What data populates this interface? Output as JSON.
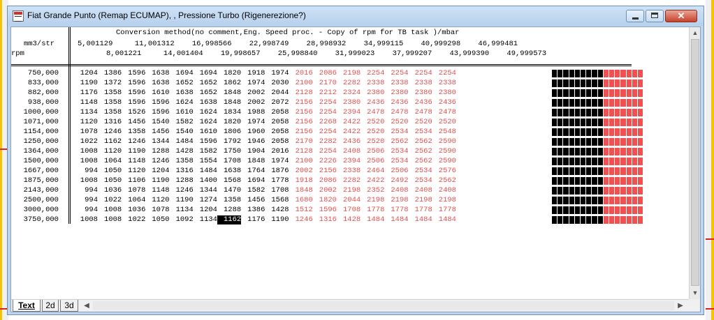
{
  "window": {
    "title": "Fiat Grande Punto (Remap ECUMAP), , Pressione Turbo (Rigenerezione?)",
    "close_glyph": "✕"
  },
  "map": {
    "heading": "Conversion method(no comment,Eng. Speed proc. - Copy of rpm for TB task )/mbar",
    "x_axis_label": "mm3/str",
    "x_axis_values_odd": "5,001129     11,001312    16,998566    22,998749    28,998932    34,999115    40,999298    46,999481",
    "x_axis_values_even": "8,001221     14,001404    19,998657    25,998840    31,999023    37,999207    43,999390    49,999573",
    "y_axis_label": "rpm",
    "rows": [
      {
        "rpm": "750,000",
        "cells": [
          "1204",
          "1386",
          "1596",
          "1638",
          "1694",
          "1694",
          "1820",
          "1918",
          "1974",
          "2016",
          "2086",
          "2198",
          "2254",
          "2254",
          "2254",
          "2254"
        ]
      },
      {
        "rpm": "833,000",
        "cells": [
          "1190",
          "1372",
          "1596",
          "1638",
          "1652",
          "1652",
          "1862",
          "1974",
          "2030",
          "2100",
          "2170",
          "2282",
          "2338",
          "2338",
          "2338",
          "2338"
        ]
      },
      {
        "rpm": "882,000",
        "cells": [
          "1176",
          "1358",
          "1596",
          "1610",
          "1638",
          "1652",
          "1848",
          "2002",
          "2044",
          "2128",
          "2212",
          "2324",
          "2380",
          "2380",
          "2380",
          "2380"
        ]
      },
      {
        "rpm": "938,000",
        "cells": [
          "1148",
          "1358",
          "1596",
          "1596",
          "1624",
          "1638",
          "1848",
          "2002",
          "2072",
          "2156",
          "2254",
          "2380",
          "2436",
          "2436",
          "2436",
          "2436"
        ]
      },
      {
        "rpm": "1000,000",
        "cells": [
          "1134",
          "1358",
          "1526",
          "1596",
          "1610",
          "1624",
          "1834",
          "1988",
          "2058",
          "2156",
          "2254",
          "2394",
          "2478",
          "2478",
          "2478",
          "2478"
        ]
      },
      {
        "rpm": "1071,000",
        "cells": [
          "1120",
          "1316",
          "1456",
          "1540",
          "1582",
          "1624",
          "1820",
          "1974",
          "2058",
          "2156",
          "2268",
          "2422",
          "2520",
          "2520",
          "2520",
          "2520"
        ]
      },
      {
        "rpm": "1154,000",
        "cells": [
          "1078",
          "1246",
          "1358",
          "1456",
          "1540",
          "1610",
          "1806",
          "1960",
          "2058",
          "2156",
          "2254",
          "2422",
          "2520",
          "2534",
          "2534",
          "2548"
        ]
      },
      {
        "rpm": "1250,000",
        "cells": [
          "1022",
          "1162",
          "1246",
          "1344",
          "1484",
          "1596",
          "1792",
          "1946",
          "2058",
          "2170",
          "2282",
          "2436",
          "2520",
          "2562",
          "2562",
          "2590"
        ]
      },
      {
        "rpm": "1364,000",
        "cells": [
          "1008",
          "1120",
          "1190",
          "1288",
          "1428",
          "1582",
          "1750",
          "1904",
          "2016",
          "2128",
          "2254",
          "2408",
          "2506",
          "2534",
          "2562",
          "2590"
        ]
      },
      {
        "rpm": "1500,000",
        "cells": [
          "1008",
          "1064",
          "1148",
          "1246",
          "1358",
          "1554",
          "1708",
          "1848",
          "1974",
          "2100",
          "2226",
          "2394",
          "2506",
          "2534",
          "2562",
          "2590"
        ]
      },
      {
        "rpm": "1667,000",
        "cells": [
          "994",
          "1050",
          "1120",
          "1204",
          "1316",
          "1484",
          "1638",
          "1764",
          "1876",
          "2002",
          "2156",
          "2338",
          "2464",
          "2506",
          "2534",
          "2576"
        ]
      },
      {
        "rpm": "1875,000",
        "cells": [
          "1008",
          "1050",
          "1106",
          "1190",
          "1288",
          "1400",
          "1568",
          "1694",
          "1778",
          "1918",
          "2086",
          "2282",
          "2422",
          "2492",
          "2534",
          "2562"
        ]
      },
      {
        "rpm": "2143,000",
        "cells": [
          "994",
          "1036",
          "1078",
          "1148",
          "1246",
          "1344",
          "1470",
          "1582",
          "1708",
          "1848",
          "2002",
          "2198",
          "2352",
          "2408",
          "2408",
          "2408"
        ]
      },
      {
        "rpm": "2500,000",
        "cells": [
          "994",
          "1022",
          "1064",
          "1120",
          "1190",
          "1274",
          "1358",
          "1456",
          "1568",
          "1680",
          "1820",
          "2044",
          "2198",
          "2198",
          "2198",
          "2198"
        ]
      },
      {
        "rpm": "3000,000",
        "cells": [
          "994",
          "1008",
          "1036",
          "1078",
          "1134",
          "1204",
          "1288",
          "1386",
          "1428",
          "1512",
          "1596",
          "1708",
          "1778",
          "1778",
          "1778",
          "1778"
        ]
      },
      {
        "rpm": "3750,000",
        "cells": [
          "1008",
          "1008",
          "1022",
          "1050",
          "1092",
          "1134",
          "1162",
          "1176",
          "1190",
          "1246",
          "1316",
          "1428",
          "1484",
          "1484",
          "1484",
          "1484"
        ]
      }
    ],
    "selected_cell": {
      "row": 15,
      "col": 6
    },
    "colors": {
      "low_value": "#000000",
      "high_value": "#e05050",
      "selection_bg": "#000000",
      "selection_fg": "#ffffff"
    }
  },
  "tabs": [
    {
      "label": "Text",
      "active": true
    },
    {
      "label": "2d",
      "active": false
    },
    {
      "label": "3d",
      "active": false
    }
  ],
  "scroll_arrows": {
    "up": "▲",
    "down": "▼",
    "left": "◀",
    "right": "▶"
  }
}
